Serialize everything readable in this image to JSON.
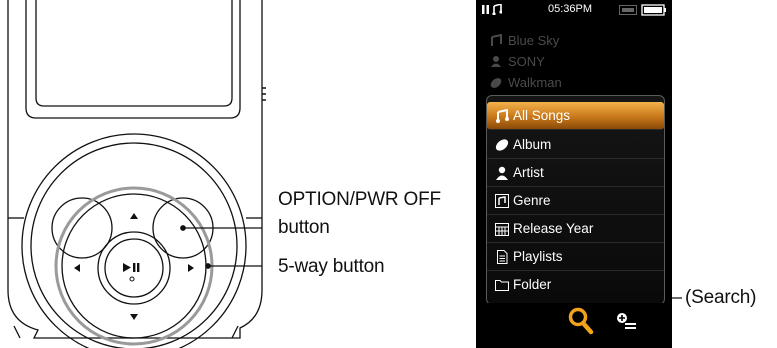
{
  "device_labels": {
    "option_button": "OPTION/PWR OFF\nbutton",
    "five_way_button": "5-way button",
    "search": "(Search)"
  },
  "screen": {
    "status": {
      "time": "05:36PM",
      "left_icons": "pause-icon, music-note-icon",
      "right_icons": "hold-icon, battery-icon"
    },
    "now_playing": {
      "title": "Blue Sky",
      "artist": "SONY",
      "album": "Walkman"
    },
    "menu": [
      {
        "label": "All Songs",
        "icon": "music-note-icon",
        "selected": true
      },
      {
        "label": "Album",
        "icon": "album-icon",
        "selected": false
      },
      {
        "label": "Artist",
        "icon": "person-icon",
        "selected": false
      },
      {
        "label": "Genre",
        "icon": "genre-icon",
        "selected": false
      },
      {
        "label": "Release Year",
        "icon": "calendar-icon",
        "selected": false
      },
      {
        "label": "Playlists",
        "icon": "playlist-icon",
        "selected": false
      },
      {
        "label": "Folder",
        "icon": "folder-icon",
        "selected": false
      }
    ],
    "bottom_icons": [
      "search-icon",
      "add-list-icon"
    ]
  },
  "colors": {
    "highlight": "#e69b2c",
    "search_icon": "#f2a31b",
    "screen_bg": "#000000"
  }
}
